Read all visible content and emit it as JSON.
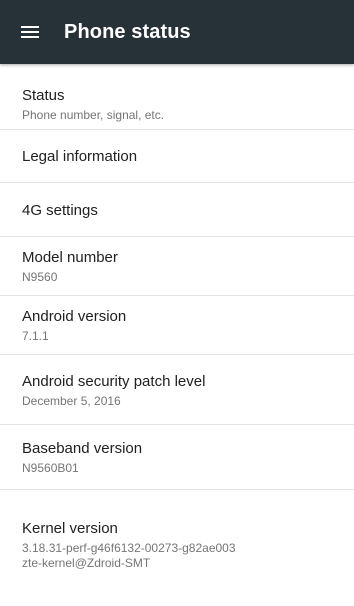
{
  "app_bar": {
    "title": "Phone status",
    "menu_icon": "hamburger-menu-icon",
    "background": "#263238",
    "text_color": "#ffffff"
  },
  "items": [
    {
      "title": "Status",
      "sub": "Phone number, signal, etc."
    },
    {
      "title": "Legal information",
      "sub": ""
    },
    {
      "title": "4G settings",
      "sub": ""
    },
    {
      "title": "Model number",
      "sub": "N9560"
    },
    {
      "title": "Android version",
      "sub": "7.1.1"
    },
    {
      "title": "Android security patch level",
      "sub": "December 5, 2016"
    },
    {
      "title": "Baseband version",
      "sub": "N9560B01"
    },
    {
      "title": "Kernel version",
      "sub": "3.18.31-perf-g46f6132-00273-g82ae003",
      "sub2": "zte-kernel@Zdroid-SMT"
    }
  ]
}
